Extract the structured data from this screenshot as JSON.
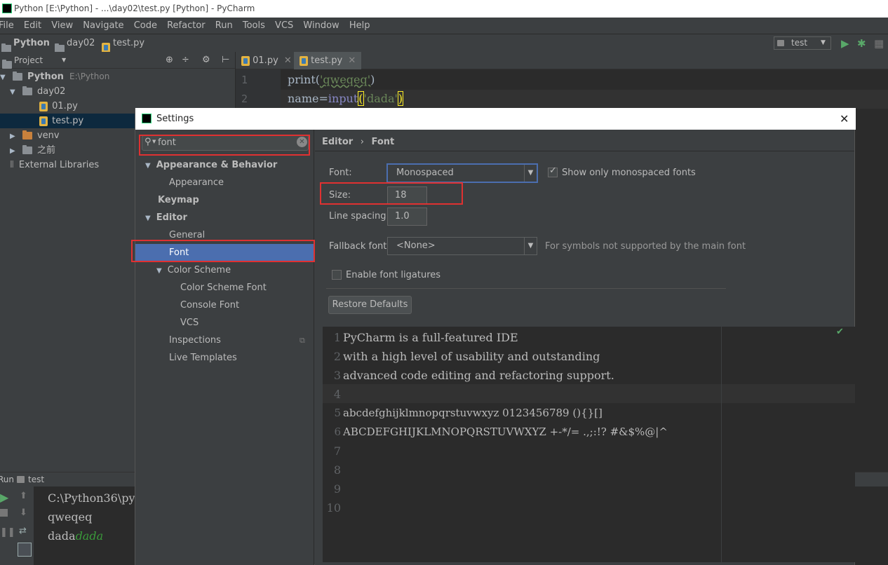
{
  "window": {
    "title": "Python [E:\\Python] - ...\\day02\\test.py [Python] - PyCharm"
  },
  "menu": [
    "File",
    "Edit",
    "View",
    "Navigate",
    "Code",
    "Refactor",
    "Run",
    "Tools",
    "VCS",
    "Window",
    "Help"
  ],
  "breadcrumb": [
    "Python",
    "day02",
    "test.py"
  ],
  "run_config": "test",
  "project": {
    "header": "Project",
    "root": "Python",
    "root_path": "E:\\Python",
    "items": {
      "day02": "day02",
      "f01": "01.py",
      "ftest": "test.py",
      "venv": "venv",
      "prev": "之前",
      "ext": "External Libraries"
    }
  },
  "tabs": [
    "01.py",
    "test.py"
  ],
  "code": {
    "lines": [
      "1",
      "2"
    ],
    "line1_fn": "print",
    "line1_open": "(",
    "line1_str": "'qweqeq'",
    "line1_close": ")",
    "line2_var": "name",
    "line2_eq": "=",
    "line2_fn": "input",
    "line2_open": "(",
    "line2_str": "'dada'",
    "line2_close": ")"
  },
  "run": {
    "label": "Run",
    "config": "test",
    "output": [
      "C:\\Python36\\py",
      "qweqeq",
      "dada"
    ],
    "input_echo": "dada"
  },
  "settings": {
    "title": "Settings",
    "search": "font",
    "tree": {
      "appearance_behavior": "Appearance & Behavior",
      "appearance": "Appearance",
      "keymap": "Keymap",
      "editor": "Editor",
      "general": "General",
      "font": "Font",
      "color_scheme": "Color Scheme",
      "color_scheme_font": "Color Scheme Font",
      "console_font": "Console Font",
      "vcs": "VCS",
      "inspections": "Inspections",
      "live_templates": "Live Templates"
    },
    "breadcrumb": {
      "parent": "Editor",
      "sep": "›",
      "current": "Font"
    },
    "font_label": "Font:",
    "font_value": "Monospaced",
    "mono_only": "Show only monospaced fonts",
    "size_label": "Size:",
    "size_value": "18",
    "line_spacing_label": "Line spacing:",
    "line_spacing_value": "1.0",
    "fallback_label": "Fallback font:",
    "fallback_value": "<None>",
    "fallback_hint": "For symbols not supported by the main font",
    "ligatures": "Enable font ligatures",
    "restore": "Restore Defaults",
    "preview": {
      "numbers": [
        "1",
        "2",
        "3",
        "4",
        "5",
        "6",
        "7",
        "8",
        "9",
        "10"
      ],
      "lines": [
        "PyCharm is a full-featured IDE",
        "with a high level of usability and outstanding",
        "advanced code editing and refactoring support.",
        "",
        "abcdefghijklmnopqrstuvwxyz 0123456789 (){}[]",
        "ABCDEFGHIJKLMNOPQRSTUVWXYZ +-*/= .,;:!? #&$%@|^",
        "",
        "",
        "",
        ""
      ]
    }
  },
  "colors": {
    "highlight": "#4b6eaf",
    "red_box": "#e03131",
    "string": "#6a8759",
    "keyword": "#cc7832"
  }
}
